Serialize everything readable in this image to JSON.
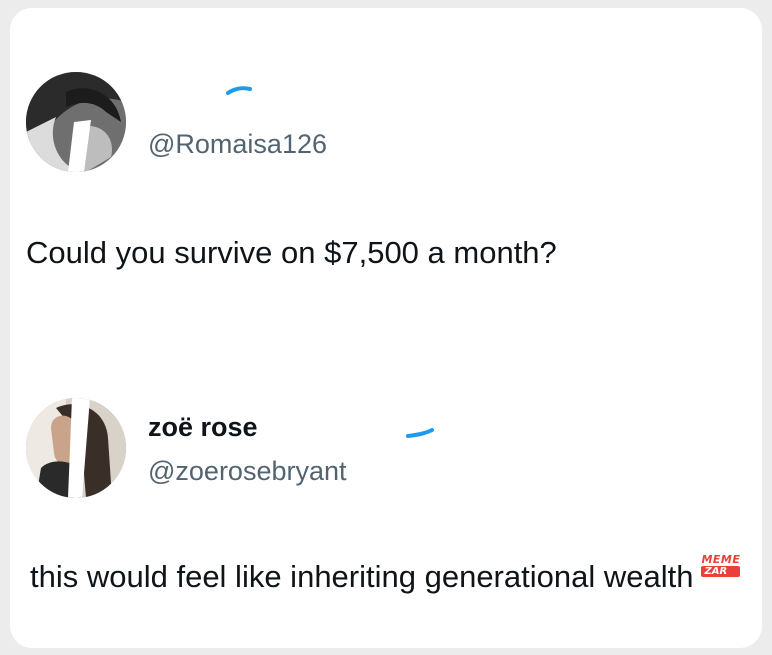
{
  "tweet": {
    "author": {
      "display_name": "",
      "handle": "@Romaisa126",
      "verified": true
    },
    "text": "Could you survive on $7,500 a month?"
  },
  "reply": {
    "author": {
      "display_name": "zoë rose",
      "handle": "@zoerosebryant",
      "verified": true
    },
    "text": "this would feel like inheriting generational wealth"
  },
  "watermark": {
    "line1": "MEME",
    "line2": "ZAR"
  },
  "colors": {
    "background": "#ececec",
    "card": "#ffffff",
    "text": "#0f1419",
    "handle": "#536471",
    "verified_badge": "#1d9bf0",
    "watermark": "#e8413a"
  },
  "icons": [
    "avatar-image",
    "verified-badge-icon"
  ]
}
